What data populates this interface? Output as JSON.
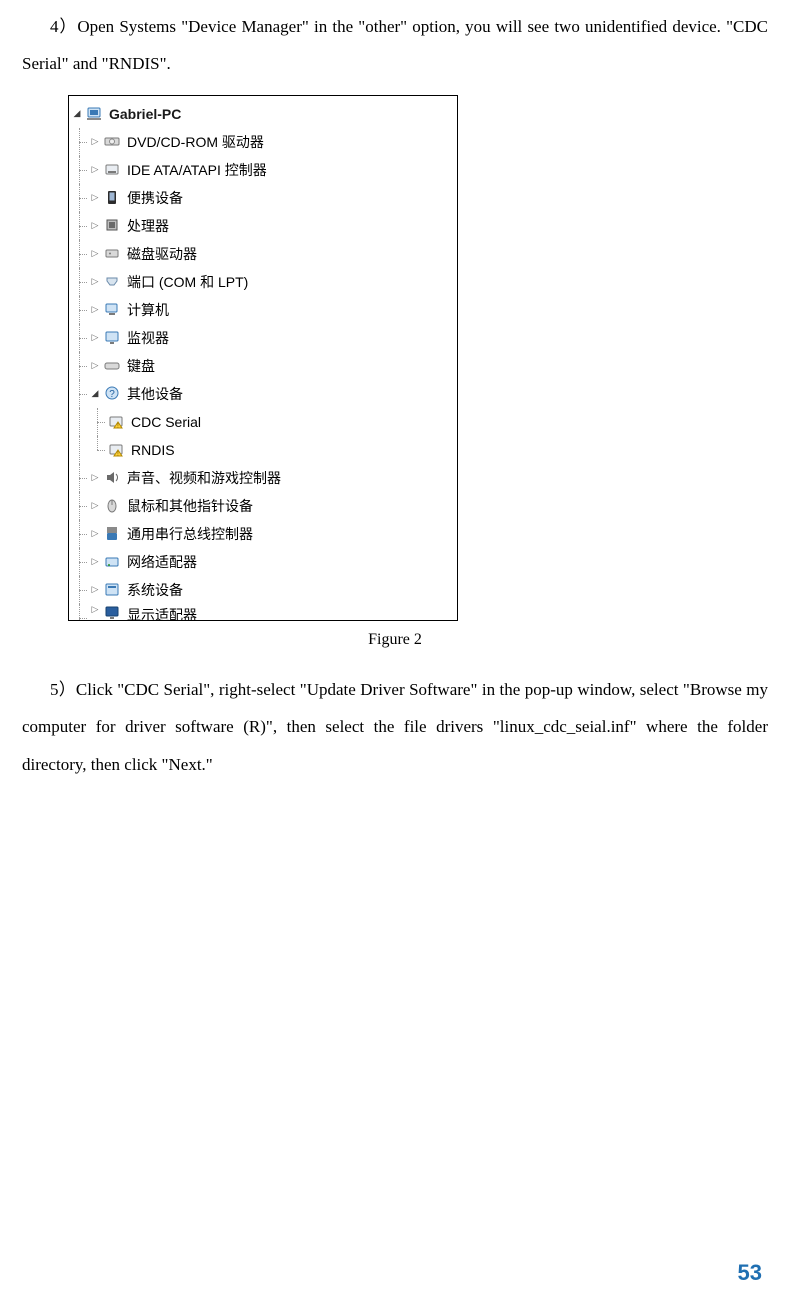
{
  "para1": "4）Open Systems \"Device Manager\" in the \"other\" option, you will see two unidentified device. \"CDC Serial\" and \"RNDIS\".",
  "figure_caption": "Figure 2",
  "para2": "5）Click \"CDC Serial\", right-select \"Update Driver Software\" in the pop-up window, select \"Browse my computer for driver software (R)\", then select the file drivers \"linux_cdc_seial.inf\" where the folder directory, then click \"Next.\"",
  "page_number": "53",
  "tree": {
    "root": "Gabriel-PC",
    "items": [
      {
        "label": "DVD/CD-ROM 驱动器",
        "icon": "disc"
      },
      {
        "label": "IDE ATA/ATAPI 控制器",
        "icon": "ide"
      },
      {
        "label": "便携设备",
        "icon": "portable"
      },
      {
        "label": "处理器",
        "icon": "cpu"
      },
      {
        "label": "磁盘驱动器",
        "icon": "disk"
      },
      {
        "label": "端口 (COM 和 LPT)",
        "icon": "port"
      },
      {
        "label": "计算机",
        "icon": "computer"
      },
      {
        "label": "监视器",
        "icon": "monitor"
      },
      {
        "label": "键盘",
        "icon": "keyboard"
      },
      {
        "label": "其他设备",
        "icon": "other",
        "open": true,
        "children": [
          {
            "label": "CDC Serial",
            "icon": "warn"
          },
          {
            "label": "RNDIS",
            "icon": "warn"
          }
        ]
      },
      {
        "label": "声音、视频和游戏控制器",
        "icon": "sound"
      },
      {
        "label": "鼠标和其他指针设备",
        "icon": "mouse"
      },
      {
        "label": "通用串行总线控制器",
        "icon": "usb"
      },
      {
        "label": "网络适配器",
        "icon": "network"
      },
      {
        "label": "系统设备",
        "icon": "system"
      },
      {
        "label": "显示适配器",
        "icon": "display",
        "cut": true
      }
    ]
  }
}
